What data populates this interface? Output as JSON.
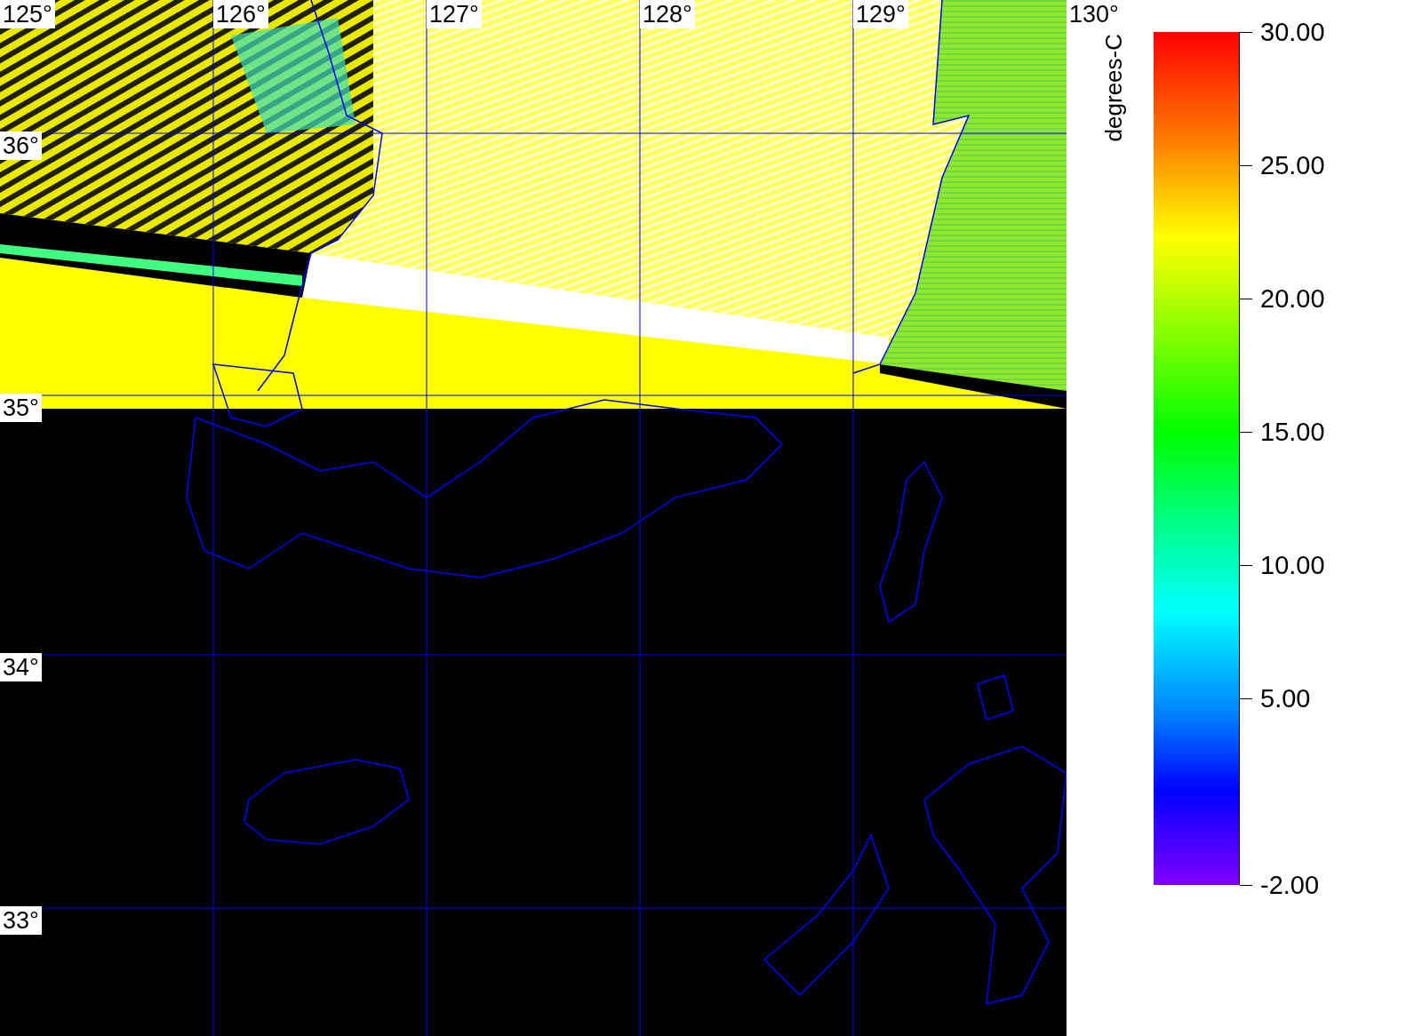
{
  "map": {
    "longitude_labels": [
      "125°",
      "126°",
      "127°",
      "128°",
      "129°",
      "130°"
    ],
    "latitude_labels": [
      "36°",
      "35°",
      "34°",
      "33°"
    ]
  },
  "colorbar": {
    "title": "degrees-C",
    "tick_labels": [
      "30.00",
      "25.00",
      "20.00",
      "15.00",
      "10.00",
      "5.00",
      "-2.00"
    ]
  }
}
